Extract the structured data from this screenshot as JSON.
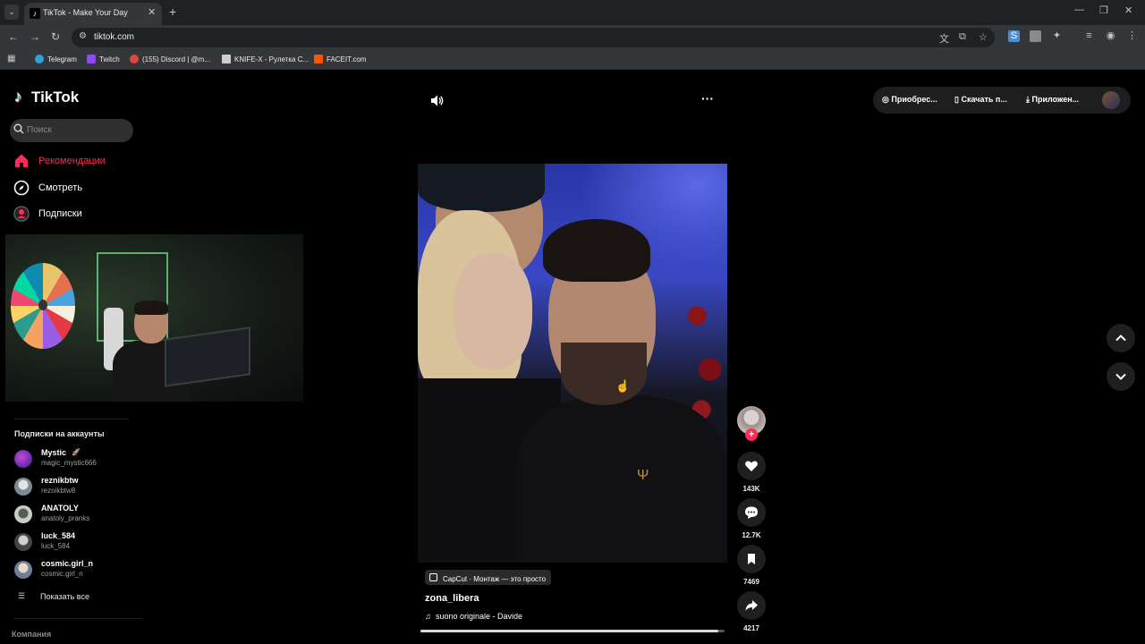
{
  "browser": {
    "tab_title": "TikTok - Make Your Day",
    "tab_favicon": "tiktok-icon",
    "address": "tiktok.com",
    "bookmarks": [
      {
        "label": "Telegram",
        "icon": "telegram-icon",
        "color": "#2aa3de"
      },
      {
        "label": "Twitch",
        "icon": "twitch-icon",
        "color": "#9146ff"
      },
      {
        "label": "(155) Discord | @m...",
        "icon": "discord-icon",
        "color": "#e0463c"
      },
      {
        "label": "KNIFE-X - Рулетка С...",
        "icon": "knifex-icon",
        "color": "#cfcfcf"
      },
      {
        "label": "FACEIT.com",
        "icon": "faceit-icon",
        "color": "#ff5500"
      }
    ]
  },
  "sidebar": {
    "logo": "TikTok",
    "search_placeholder": "Поиск",
    "nav": [
      {
        "label": "Рекомендации",
        "icon": "home-icon",
        "active": true
      },
      {
        "label": "Смотреть",
        "icon": "compass-icon",
        "active": false
      },
      {
        "label": "Подписки",
        "icon": "following-icon",
        "active": false
      }
    ],
    "following_title": "Подписки на аккаунты",
    "accounts": [
      {
        "name": "Mystic",
        "handle": "magic_mystic666",
        "color": "#6a3fd1"
      },
      {
        "name": "reznikbtw",
        "handle": "reznikbtw8",
        "color": "#8e9aa3"
      },
      {
        "name": "ANATOLY",
        "handle": "anatoly_pranks",
        "color": "#a7b3a4"
      },
      {
        "name": "luck_584",
        "handle": "luck_584",
        "color": "#6c6c6c"
      },
      {
        "name": "cosmic.girl_n",
        "handle": "cosmic.girl_n",
        "color": "#9aa6b8"
      }
    ],
    "show_all": "Показать все",
    "company": "Компания"
  },
  "header": {
    "buy": "Приобрес...",
    "download": "Скачать п...",
    "app": "Приложен..."
  },
  "video": {
    "capcut": "CapCut · Монтаж — это просто",
    "author": "zona_libera",
    "music": "suono originale - Davide",
    "progress": 0.98
  },
  "actions": {
    "likes": "143K",
    "comments": "12.7K",
    "saves": "7469",
    "shares": "4217"
  },
  "colors": {
    "accent": "#fe2c55",
    "background": "#000000"
  }
}
